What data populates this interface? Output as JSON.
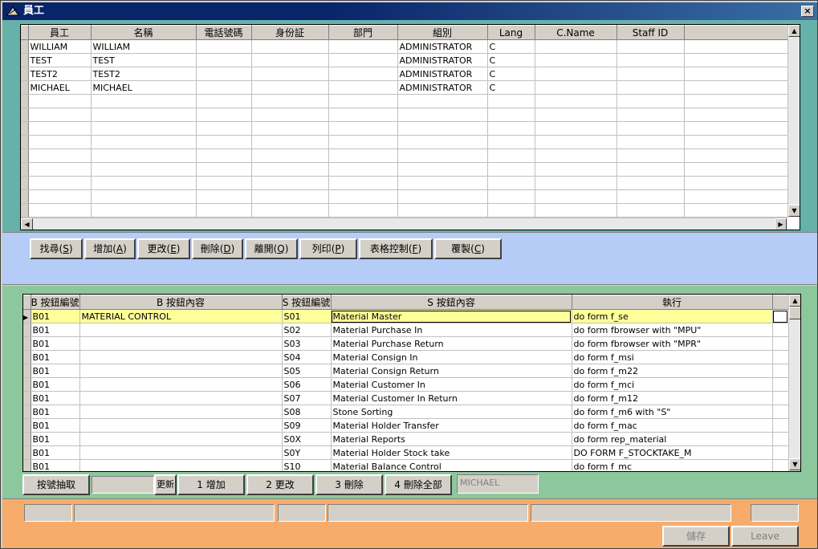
{
  "window": {
    "title": "員工",
    "close_label": "×"
  },
  "staff_grid": {
    "columns": [
      "員工",
      "名稱",
      "電話號碼",
      "身份証",
      "部門",
      "組別",
      "Lang",
      "C.Name",
      "Staff ID"
    ],
    "rows": [
      [
        "WILLIAM",
        "WILLIAM",
        "",
        "",
        "",
        "ADMINISTRATOR",
        "C",
        "",
        ""
      ],
      [
        "TEST",
        "TEST",
        "",
        "",
        "",
        "ADMINISTRATOR",
        "C",
        "",
        ""
      ],
      [
        "TEST2",
        "TEST2",
        "",
        "",
        "",
        "ADMINISTRATOR",
        "C",
        "",
        ""
      ],
      [
        "MICHAEL",
        "MICHAEL",
        "",
        "",
        "",
        "ADMINISTRATOR",
        "C",
        "",
        ""
      ]
    ]
  },
  "toolbar": {
    "buttons": [
      {
        "label": "找尋",
        "key": "S"
      },
      {
        "label": "增加",
        "key": "A"
      },
      {
        "label": "更改",
        "key": "E"
      },
      {
        "label": "刪除",
        "key": "D"
      },
      {
        "label": "離開",
        "key": "Q"
      },
      {
        "label": "列印",
        "key": "P"
      },
      {
        "label": "表格控制",
        "key": "F"
      },
      {
        "label": "覆製",
        "key": "C"
      }
    ]
  },
  "button_grid": {
    "columns": [
      "B 按鈕編號",
      "B 按鈕內容",
      "S 按鈕編號",
      "S 按鈕內容",
      "執行"
    ],
    "rows": [
      [
        "B01",
        "MATERIAL CONTROL",
        "S01",
        "Material Master",
        "do form f_se"
      ],
      [
        "B01",
        "",
        "S02",
        "Material Purchase In",
        "do form fbrowser with \"MPU\""
      ],
      [
        "B01",
        "",
        "S03",
        "Material Purchase Return",
        "do form fbrowser with \"MPR\""
      ],
      [
        "B01",
        "",
        "S04",
        "Material Consign In",
        "do form f_msi"
      ],
      [
        "B01",
        "",
        "S05",
        "Material Consign Return",
        "do form f_m22"
      ],
      [
        "B01",
        "",
        "S06",
        "Material Customer In",
        "do form f_mci"
      ],
      [
        "B01",
        "",
        "S07",
        "Material Customer In Return",
        "do form f_m12"
      ],
      [
        "B01",
        "",
        "S08",
        "Stone Sorting",
        "do form f_m6 with \"S\""
      ],
      [
        "B01",
        "",
        "S09",
        "Material Holder Transfer",
        "do form f_mac"
      ],
      [
        "B01",
        "",
        "S0X",
        "Material Reports",
        "do form rep_material"
      ],
      [
        "B01",
        "",
        "S0Y",
        "Material Holder Stock take",
        "DO FORM  F_STOCKTAKE_M"
      ],
      [
        "B01",
        "",
        "S10",
        "Material Balance Control",
        "do form f_mc"
      ]
    ]
  },
  "bottom_bar": {
    "extract_label": "按號抽取",
    "refresh_label": "更新",
    "add_label": "1 增加",
    "edit_label": "2 更改",
    "delete_label": "3 刪除",
    "delete_all_label": "4 刪除全部",
    "user_value": "MICHAEL"
  },
  "footer": {
    "save_label": "儲存",
    "leave_label": "Leave"
  },
  "colors": {
    "top_panel": "#66b2aa",
    "toolbar_panel": "#b4ccf6",
    "mid_panel": "#8cc89c",
    "footer_panel": "#f8ac6c",
    "highlight_row": "#ffff99"
  }
}
